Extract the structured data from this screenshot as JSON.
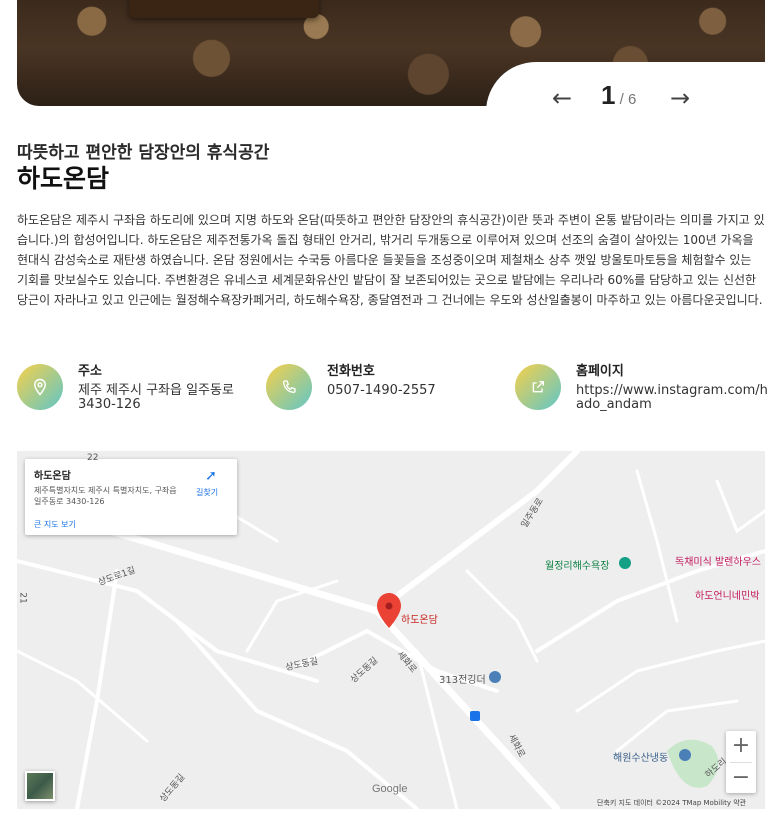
{
  "slider": {
    "current": "1",
    "separator": "/",
    "total": "6",
    "prev_icon": "arrow-left-icon",
    "next_icon": "arrow-right-icon"
  },
  "place": {
    "subtitle": "따뜻하고 편안한 담장안의 휴식공간",
    "title": "하도온담",
    "description": "하도온담은 제주시 구좌읍 하도리에 있으며 지명 하도와 온담(따뜻하고 편안한 담장안의 휴식공간)이란 뜻과 주변이 온통 밭담이라는 의미를 가지고 있습니다.)의 합성어입니다. 하도온담은 제주전통가옥 돌집 형태인 안거리, 밖거리 두개동으로 이루어져 있으며 선조의 숨결이 살아있는 100년 가옥을 현대식 감성숙소로 재탄생 하였습니다. 온담 정원에서는 수국등 아름다운 들꽃들을 조성중이오며 제철채소 상추 깻잎 방울토마토등을 체험할수 있는 기회를 맛보실수도 있습니다. 주변환경은 유네스코 세계문화유산인 밭담이 잘 보존되어있는 곳으로 밭담에는 우리나라 60%를 담당하고 있는 신선한 당근이 자라나고 있고 인근에는 월정해수욕장카페거리, 하도해수욕장, 종달염전과 그 건너에는 우도와 성산일출봉이 마주하고 있는 아름다운곳입니다."
  },
  "info": {
    "address": {
      "label": "주소",
      "value": "제주 제주시 구좌읍 일주동로 3430-126",
      "icon": "location-pin-icon"
    },
    "phone": {
      "label": "전화번호",
      "value": "0507-1490-2557",
      "icon": "phone-icon"
    },
    "homepage": {
      "label": "홈페이지",
      "value": "https://www.instagram.com/hado_andam",
      "icon": "external-link-icon"
    }
  },
  "map": {
    "card": {
      "name": "하도온담",
      "address": "제주특별자치도 제주시 특별자치도, 구좌읍 일주동로 3430-126",
      "larger_map": "큰 지도 보기",
      "directions": "길찾기"
    },
    "marker_label": "하도온담",
    "labels": {
      "road1": "상도로1길",
      "road2": "상도동길",
      "road3": "상도동길",
      "road4": "세화로",
      "road5": "세화로",
      "road6": "일주동로",
      "road7": "상도동길",
      "num": "22",
      "edge": "21"
    },
    "pois": {
      "beach": "월정리해수욕장",
      "store1": "독채미식 발렌하우스",
      "store2": "하도언니네민박",
      "store3": "313전깅더",
      "fish": "해원수산냉동",
      "village": "하도리"
    },
    "zoom_in": "+",
    "zoom_out": "−",
    "google": "Google",
    "attribution": "단축키   지도 데이터 ©2024 TMap Mobility   약관"
  },
  "colors": {
    "icon_gradient_start": "#f7d04a",
    "icon_gradient_end": "#5fc6c8",
    "marker": "#ea4335",
    "link": "#1a73e8"
  }
}
